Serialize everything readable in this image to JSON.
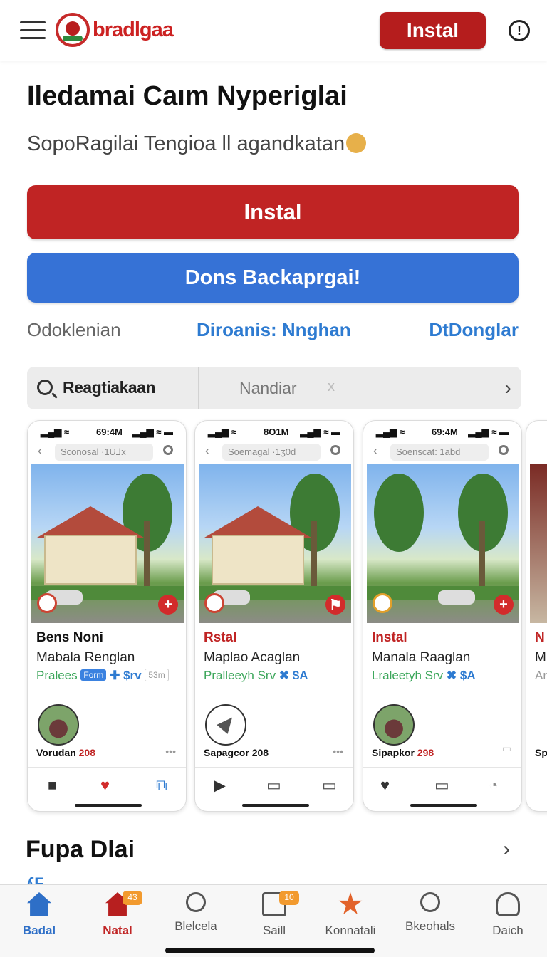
{
  "header": {
    "brand": "bradlgaa",
    "install_label": "Instal"
  },
  "hero": {
    "title": "Iledamai Caım Nyperiglai",
    "subtitle": "SopoRagilai Tengioa ll agandkatan",
    "install_label": "Instal",
    "secondary_label": "Dons Backaprgai!"
  },
  "links": {
    "left": "Odoklenian",
    "middle": "Diroanis: Nnghan",
    "right": "DtDonglar"
  },
  "search": {
    "term": "Reagtiakaan",
    "placeholder": "Nandiar",
    "clear": "x"
  },
  "cards": [
    {
      "signal": "▂▄▆ ≈",
      "time": "69:4M",
      "battery": "▂▄▆ ≈ ▬",
      "url": "Sconosal ·1Ʋ⅃x",
      "title": "Bens Noni",
      "line": "Mabala Renglan",
      "tags": "Praleеs",
      "chip": "Form",
      "tag_extra": "✚ $rv",
      "chip_grey": "53m",
      "footer_name": "Vorudan",
      "footer_num": "208",
      "dots": "•••"
    },
    {
      "signal": "▂▄▆ ≈",
      "time": "8O1M",
      "battery": "▂▄▆ ≈ ▬",
      "url": "Soemagal ·1ʒ0d",
      "title": "Rstal",
      "line": "Maplao Acaglan",
      "tags": "Pralleeyh Srv",
      "tag_extra": "✖ $A",
      "footer_name": "Sapagcor",
      "footer_num": "208",
      "dots": "•••"
    },
    {
      "signal": "▂▄▆ ≈",
      "time": "69:4M",
      "battery": "▂▄▆ ≈ ▬",
      "url": "Soenscat: 1abd",
      "title": "Instal",
      "line": "Manala Raaglan",
      "tags": "Lraleetyh Srv",
      "tag_extra": "✖ $A",
      "footer_name": "Sipapkor",
      "footer_num": "298",
      "dots": ""
    }
  ],
  "card_peek": {
    "title": "N",
    "line": "M",
    "tags": "Ar",
    "footer": "Sp"
  },
  "section": {
    "title": "Fupa Dlai",
    "peek": "ʎF"
  },
  "tabbar": [
    {
      "label": "Badal",
      "badge": ""
    },
    {
      "label": "Natal",
      "badge": "43"
    },
    {
      "label": "Blelcela",
      "badge": ""
    },
    {
      "label": "Saill",
      "badge": "10"
    },
    {
      "label": "Konnatali",
      "badge": ""
    },
    {
      "label": "Bkeohals",
      "badge": ""
    },
    {
      "label": "Daich",
      "badge": ""
    }
  ],
  "colors": {
    "brand_red": "#c02424",
    "link_blue": "#2e7bd1",
    "button_blue": "#3672d6",
    "badge_orange": "#f29a2e"
  }
}
